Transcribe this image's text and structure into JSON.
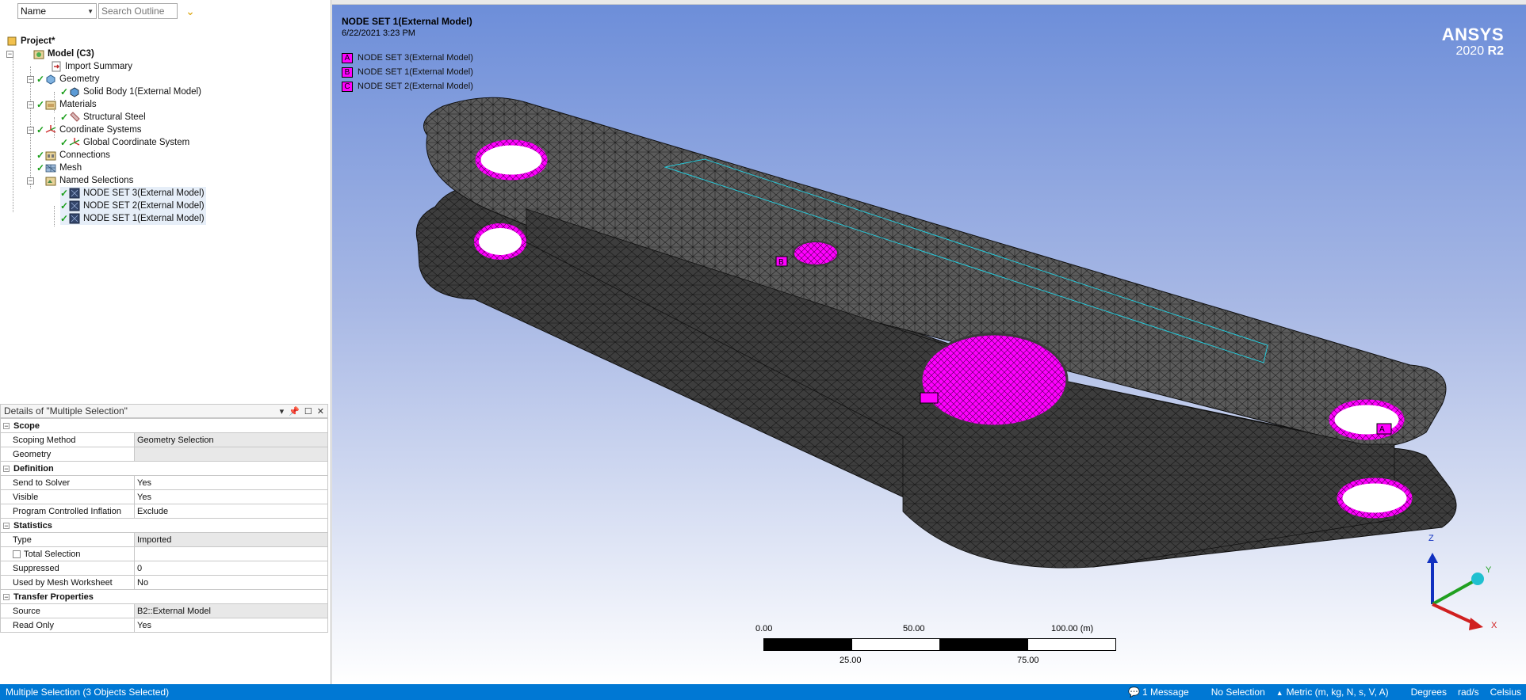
{
  "outline": {
    "filter_combo": "Name",
    "search_placeholder": "Search Outline",
    "tree": [
      {
        "label": "Project*",
        "bold": true
      },
      {
        "label": "Model (C3)",
        "bold": true
      },
      {
        "label": "Import Summary"
      },
      {
        "label": "Geometry"
      },
      {
        "label": "Solid Body 1(External Model)"
      },
      {
        "label": "Materials"
      },
      {
        "label": "Structural Steel"
      },
      {
        "label": "Coordinate Systems"
      },
      {
        "label": "Global Coordinate System"
      },
      {
        "label": "Connections"
      },
      {
        "label": "Mesh"
      },
      {
        "label": "Named Selections"
      },
      {
        "label": "NODE SET 3(External Model)"
      },
      {
        "label": "NODE SET 2(External Model)"
      },
      {
        "label": "NODE SET 1(External Model)"
      }
    ]
  },
  "details": {
    "title": "Details of \"Multiple Selection\"",
    "categories": [
      {
        "name": "Scope",
        "rows": [
          {
            "key": "Scoping Method",
            "value": "Geometry Selection",
            "gray": true
          },
          {
            "key": "Geometry",
            "value": "",
            "gray": true
          }
        ]
      },
      {
        "name": "Definition",
        "rows": [
          {
            "key": "Send to Solver",
            "value": "Yes"
          },
          {
            "key": "Visible",
            "value": "Yes"
          },
          {
            "key": "Program Controlled Inflation",
            "value": "Exclude"
          }
        ]
      },
      {
        "name": "Statistics",
        "rows": [
          {
            "key": "Type",
            "value": "Imported",
            "gray": true
          },
          {
            "key": "Total Selection",
            "value": "",
            "checkbox": true
          },
          {
            "key": "Suppressed",
            "value": "0"
          },
          {
            "key": "Used by Mesh Worksheet",
            "value": "No"
          }
        ]
      },
      {
        "name": "Transfer Properties",
        "rows": [
          {
            "key": "Source",
            "value": "B2::External Model",
            "gray": true
          },
          {
            "key": "Read Only",
            "value": "Yes"
          }
        ]
      }
    ]
  },
  "viewport": {
    "title": "NODE SET 1(External Model)",
    "date": "6/22/2021 3:23 PM",
    "legend": [
      {
        "tag": "A",
        "label": "NODE SET 3(External Model)"
      },
      {
        "tag": "B",
        "label": "NODE SET 1(External Model)"
      },
      {
        "tag": "C",
        "label": "NODE SET 2(External Model)"
      }
    ],
    "logo_brand": "ANSYS",
    "logo_version": "2020",
    "logo_release": "R2",
    "scale": {
      "top_labels": [
        "0.00",
        "50.00",
        "100.00 (m)"
      ],
      "bottom_labels": [
        "25.00",
        "75.00"
      ]
    },
    "axes": {
      "x": "X",
      "y": "Y",
      "z": "Z"
    },
    "colors": {
      "highlight": "#ff00ff",
      "mesh": "#5a5a5a",
      "background_top": "#6d8ed9"
    }
  },
  "status": {
    "left": "Multiple Selection (3 Objects Selected)",
    "message": "1 Message",
    "selection": "No Selection",
    "units": "Metric (m, kg, N, s, V, A)",
    "angle": "Degrees",
    "rotation": "rad/s",
    "temperature": "Celsius"
  }
}
